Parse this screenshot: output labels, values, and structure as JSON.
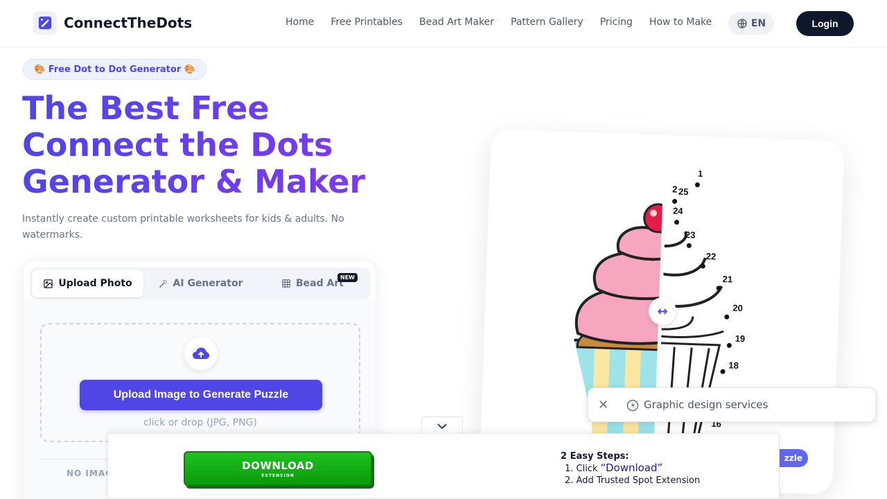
{
  "brand": {
    "name": "ConnectTheDots",
    "logo_icon": "pencil-ruler-icon"
  },
  "nav": {
    "items": [
      "Home",
      "Free Printables",
      "Bead Art Maker",
      "Pattern Gallery",
      "Pricing",
      "How to Make"
    ],
    "language": "EN",
    "login": "Login"
  },
  "hero": {
    "badge": "🎨 Free Dot to Dot Generator 🎨",
    "title_lines": [
      "The Best Free",
      "Connect the Dots",
      "Generator & Maker"
    ],
    "subtitle": "Instantly create custom printable worksheets for kids & adults. No watermarks."
  },
  "upload_card": {
    "tabs": [
      {
        "label": "Upload Photo",
        "icon": "image-icon",
        "active": true
      },
      {
        "label": "AI Generator",
        "icon": "magic-wand-icon",
        "active": false
      },
      {
        "label": "Bead Art",
        "icon": "grid-icon",
        "active": false
      }
    ],
    "new_badge": "NEW",
    "upload_button": "Upload Image to Generate Puzzle",
    "upload_hint": "click or drop (JPG, PNG)",
    "no_image_label": "NO IMAG"
  },
  "preview": {
    "dot_numbers": [
      "1",
      "2",
      "25",
      "24",
      "23",
      "22",
      "21",
      "20",
      "19",
      "18",
      "16"
    ],
    "handle_icon": "arrows-horizontal-icon",
    "pill_label": "zzle"
  },
  "ad_snippet": {
    "text": "Graphic design services",
    "close_icon": "close-icon",
    "icon": "lightning-icon"
  },
  "ad_bar": {
    "download_label": "DOWNLOAD",
    "download_sub": "EXTENSION",
    "steps_title": "2 Easy Steps:",
    "step1_prefix": "1. Click ",
    "step1_quote": "“Download”",
    "step2": "2. Add Trusted Spot Extension"
  },
  "colors": {
    "accent": "#4f46e5",
    "accent_purple": "#7c3aed",
    "dark": "#0f172a",
    "download_green": "#12b312"
  }
}
